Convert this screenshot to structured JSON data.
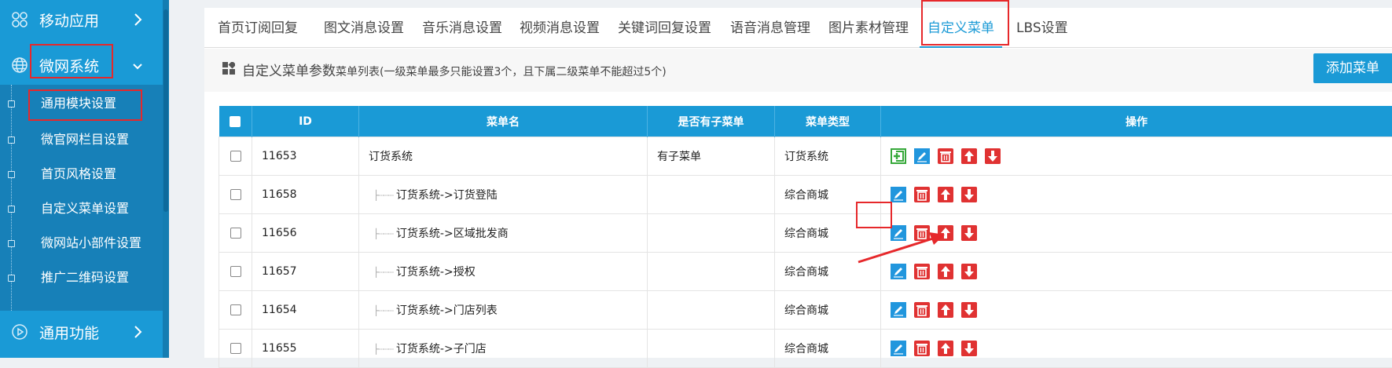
{
  "sidebar": {
    "menu1": {
      "label": "移动应用",
      "icon": "apps-icon"
    },
    "menu2": {
      "label": "微网系统",
      "icon": "globe-icon"
    },
    "menu3": {
      "label": "通用功能",
      "icon": "play-icon"
    },
    "submenu": [
      {
        "label": "通用模块设置"
      },
      {
        "label": "微官网栏目设置"
      },
      {
        "label": "首页风格设置"
      },
      {
        "label": "自定义菜单设置"
      },
      {
        "label": "微网站小部件设置"
      },
      {
        "label": "推广二维码设置"
      }
    ]
  },
  "tabs": [
    {
      "label": "首页订阅回复"
    },
    {
      "label": "图文消息设置"
    },
    {
      "label": "音乐消息设置"
    },
    {
      "label": "视频消息设置"
    },
    {
      "label": "关键词回复设置"
    },
    {
      "label": "语音消息管理"
    },
    {
      "label": "图片素材管理"
    },
    {
      "label": "自定义菜单",
      "active": true
    },
    {
      "label": "LBS设置"
    }
  ],
  "toolbar": {
    "title": "自定义菜单参数",
    "note": "菜单列表(一级菜单最多只能设置3个，且下属二级菜单不能超过5个)",
    "add_button": "添加菜单"
  },
  "table": {
    "headers": {
      "id": "ID",
      "name": "菜单名",
      "has_sub": "是否有子菜单",
      "type": "菜单类型",
      "ops": "操作"
    },
    "rows": [
      {
        "id": "11653",
        "name": "订货系统",
        "child": false,
        "has_sub": "有子菜单",
        "type": "订货系统"
      },
      {
        "id": "11658",
        "name": "订货系统->订货登陆",
        "child": true,
        "has_sub": "",
        "type": "综合商城"
      },
      {
        "id": "11656",
        "name": "订货系统->区域批发商",
        "child": true,
        "has_sub": "",
        "type": "综合商城"
      },
      {
        "id": "11657",
        "name": "订货系统->授权",
        "child": true,
        "has_sub": "",
        "type": "综合商城"
      },
      {
        "id": "11654",
        "name": "订货系统->门店列表",
        "child": true,
        "has_sub": "",
        "type": "综合商城"
      },
      {
        "id": "11655",
        "name": "订货系统->子门店",
        "child": true,
        "has_sub": "",
        "type": "综合商城"
      }
    ]
  },
  "colors": {
    "accent": "#1a9ad6",
    "highlight": "#e6282b",
    "danger": "#e03232"
  }
}
